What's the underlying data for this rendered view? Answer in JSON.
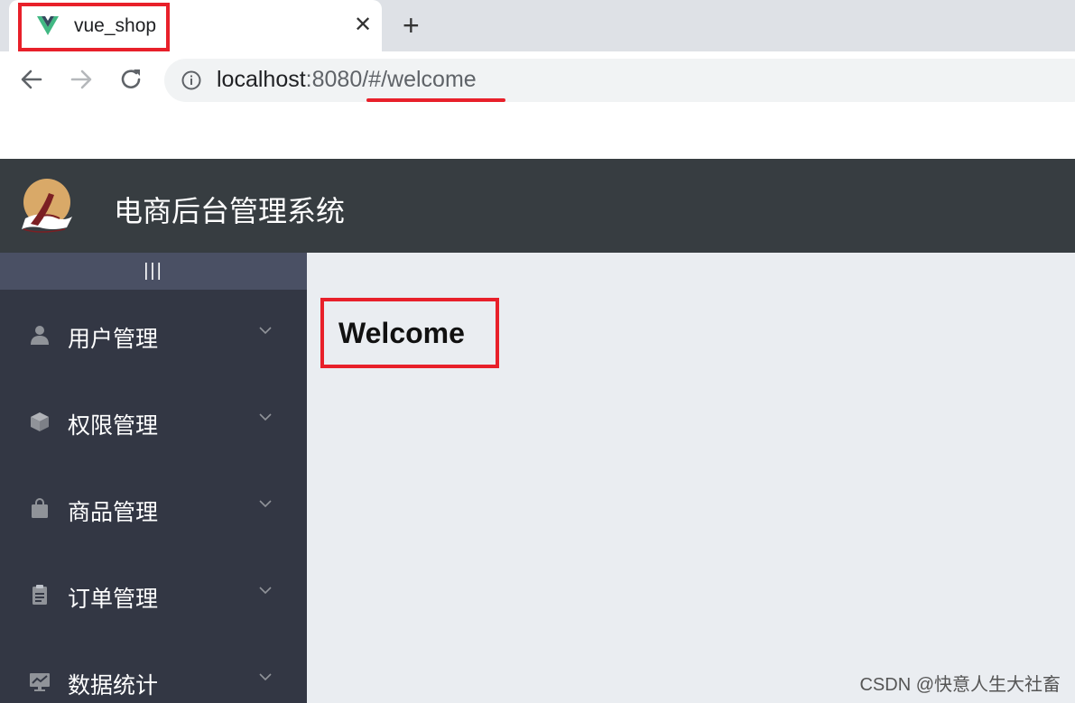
{
  "browser": {
    "tab": {
      "title": "vue_shop",
      "close_glyph": "✕",
      "favicon": "vue-logo-icon"
    },
    "new_tab_glyph": "+",
    "nav": {
      "back": "arrow-left-icon",
      "forward": "arrow-right-icon",
      "reload": "reload-icon"
    },
    "address": {
      "host": "localhost",
      "port_and_path": ":8080/#/welcome"
    },
    "highlight_color": "#e8202a"
  },
  "app": {
    "header": {
      "title": "电商后台管理系统",
      "background": "#373d41"
    },
    "sidebar": {
      "toggle_label": "|||",
      "background": "#333744",
      "toggle_background": "#4a5064",
      "items": [
        {
          "label": "用户管理",
          "icon": "user-icon"
        },
        {
          "label": "权限管理",
          "icon": "box-icon"
        },
        {
          "label": "商品管理",
          "icon": "shopping-bag-icon"
        },
        {
          "label": "订单管理",
          "icon": "clipboard-icon"
        },
        {
          "label": "数据统计",
          "icon": "chart-icon"
        }
      ]
    },
    "main": {
      "heading": "Welcome",
      "background": "#eaedf1"
    }
  },
  "watermark": "CSDN @快意人生大社畜"
}
